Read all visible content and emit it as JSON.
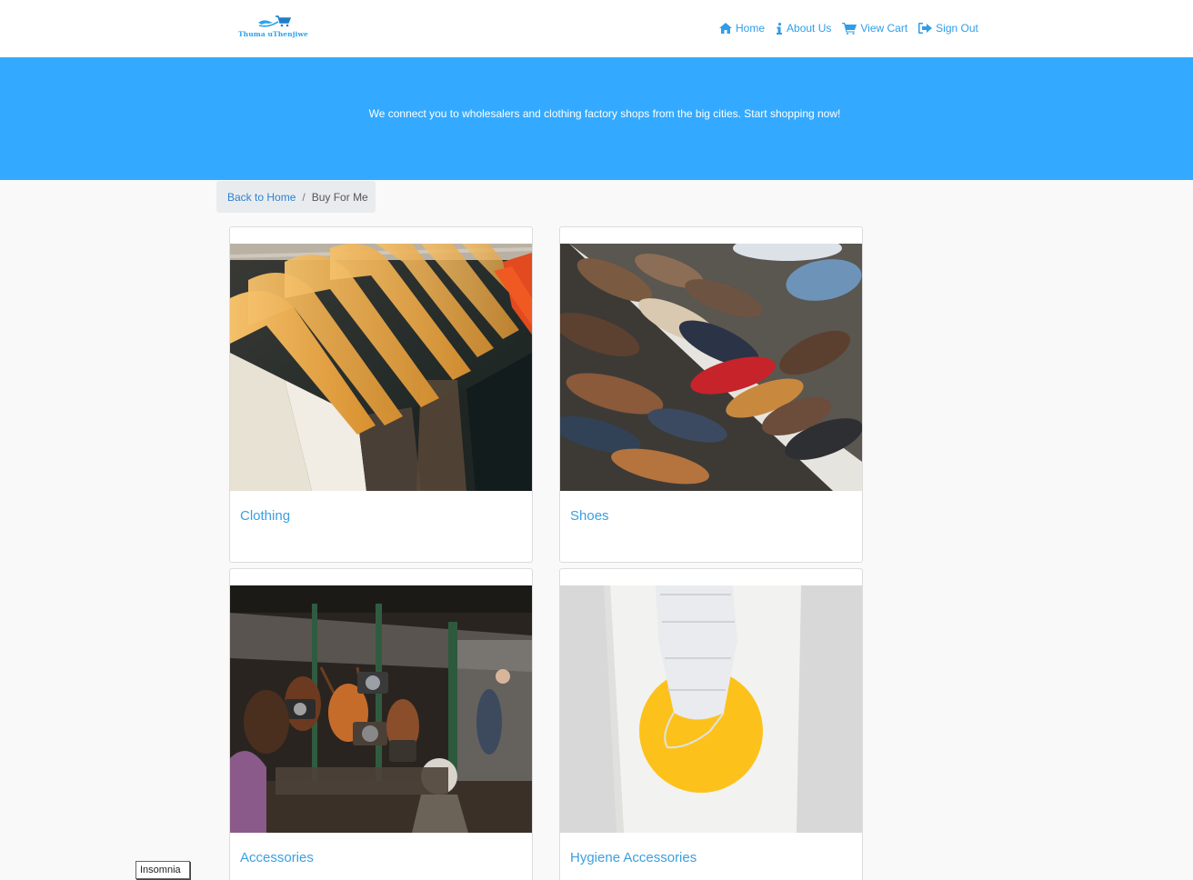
{
  "header": {
    "logo_text": "Thuma uThenjiwe",
    "nav": [
      {
        "label": "Home",
        "icon": "home-icon"
      },
      {
        "label": "About Us",
        "icon": "info-icon"
      },
      {
        "label": "View Cart",
        "icon": "cart-icon"
      },
      {
        "label": "Sign Out",
        "icon": "sign-out-icon"
      }
    ]
  },
  "hero": {
    "text": "We connect you to wholesalers and clothing factory shops from the big cities. Start shopping now!"
  },
  "breadcrumb": {
    "back_label": "Back to Home",
    "separator": "/",
    "current": "Buy For Me"
  },
  "categories": [
    {
      "title": "Clothing",
      "image": "clothes-on-hangers-photo"
    },
    {
      "title": "Shoes",
      "image": "shoes-on-shelf-photo"
    },
    {
      "title": "Accessories",
      "image": "market-bags-and-cameras-photo"
    },
    {
      "title": "Hygiene Accessories",
      "image": "face-mask-in-paper-bag-photo"
    }
  ],
  "tooltip": {
    "text": "Insomnia"
  },
  "colors": {
    "accent": "#33aaff",
    "link": "#2f9ee8",
    "card_title": "#3b9fe0"
  }
}
